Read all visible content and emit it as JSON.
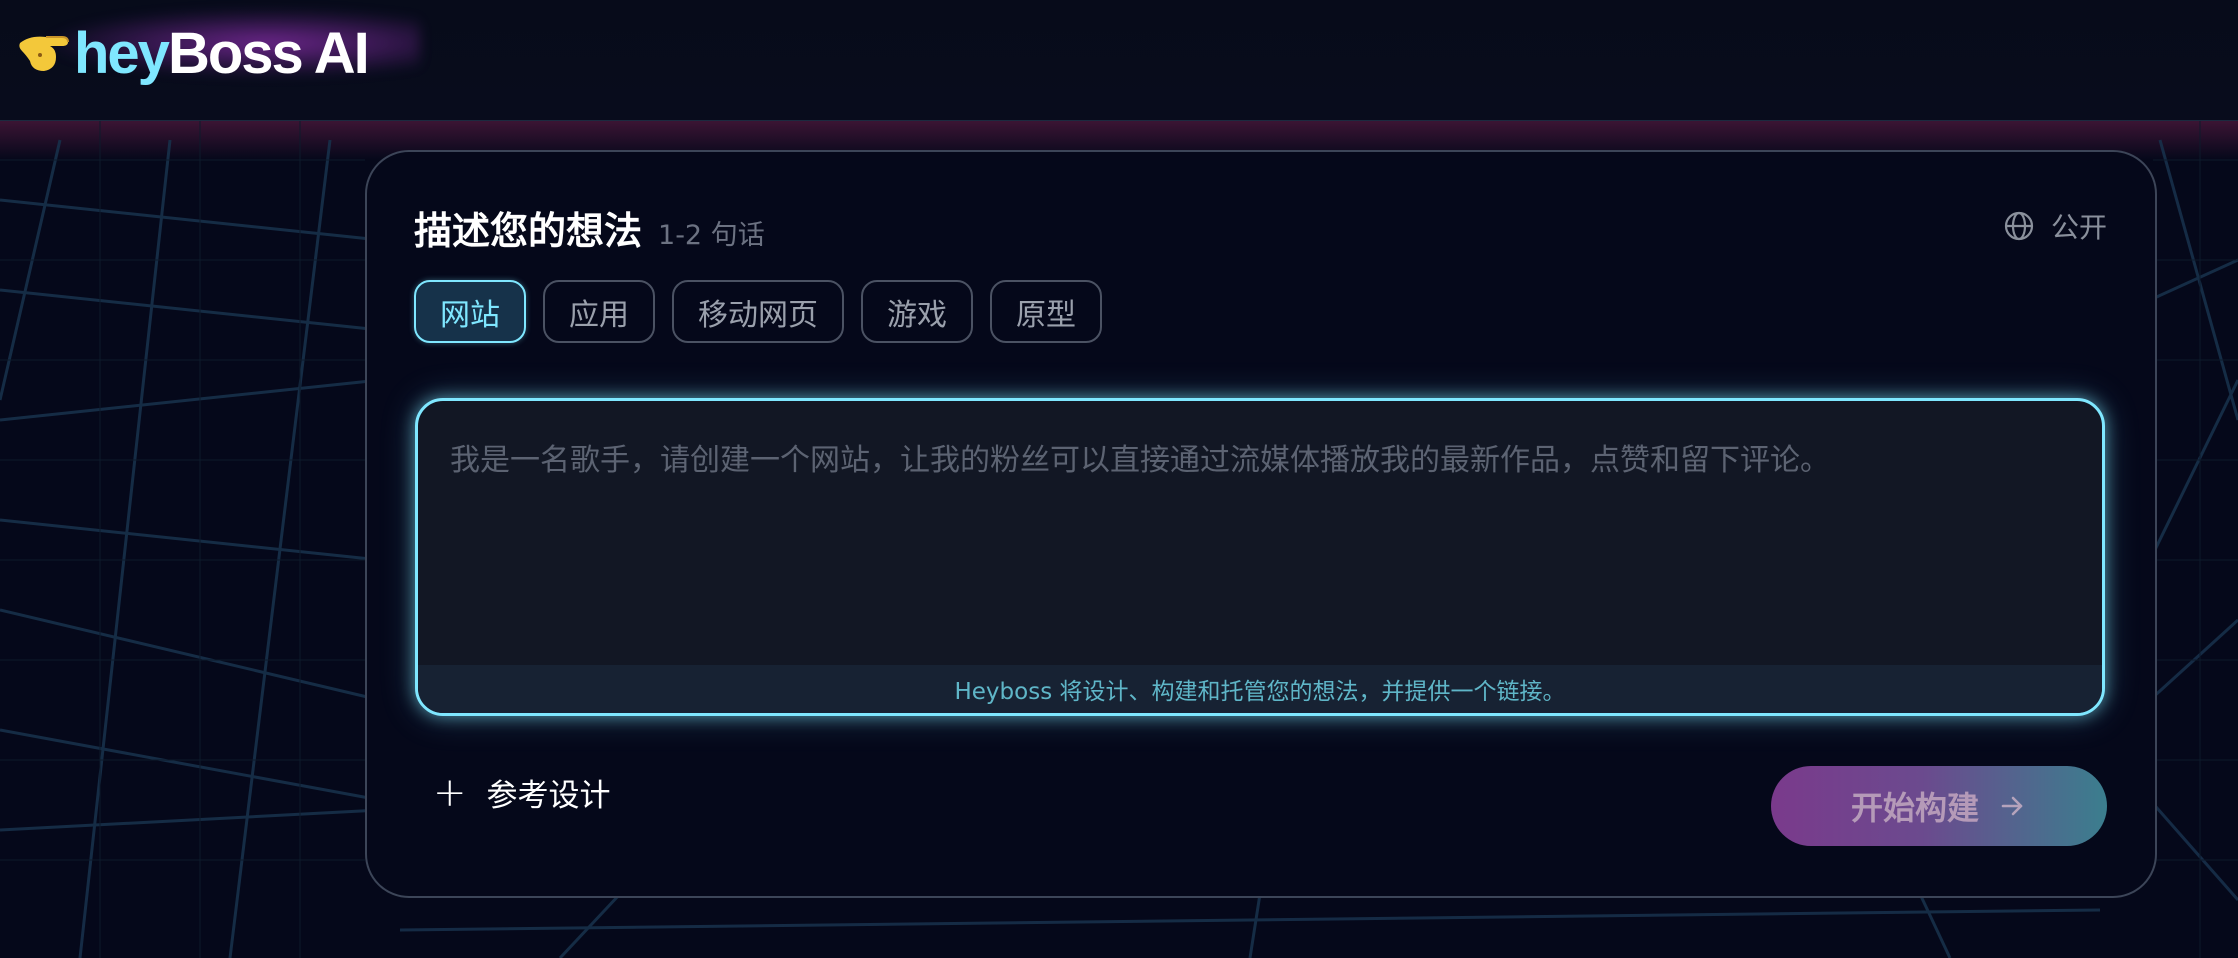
{
  "header": {
    "logo": {
      "hey": "hey",
      "boss": "Boss",
      "ai": "AI"
    }
  },
  "card": {
    "title": "描述您的想法",
    "title_hint": "1-2 句话",
    "visibility": {
      "label": "公开",
      "icon": "globe-icon"
    },
    "tabs": [
      {
        "label": "网站",
        "active": true
      },
      {
        "label": "应用",
        "active": false
      },
      {
        "label": "移动网页",
        "active": false
      },
      {
        "label": "游戏",
        "active": false
      },
      {
        "label": "原型",
        "active": false
      }
    ],
    "prompt": {
      "value": "",
      "placeholder": "我是一名歌手，请创建一个网站，让我的粉丝可以直接通过流媒体播放我的最新作品，点赞和留下评论。",
      "footer_note": "Heyboss 将设计、构建和托管您的想法，并提供一个链接。"
    },
    "reference_design": {
      "label": "参考设计",
      "icon": "plus-icon"
    },
    "build_button": {
      "label": "开始构建",
      "icon": "arrow-right-icon"
    }
  },
  "colors": {
    "background": "#05081a",
    "accent_cyan": "#7fe7ff",
    "button_gradient_start": "#7a3a8c",
    "button_gradient_end": "#3b7e8e"
  }
}
